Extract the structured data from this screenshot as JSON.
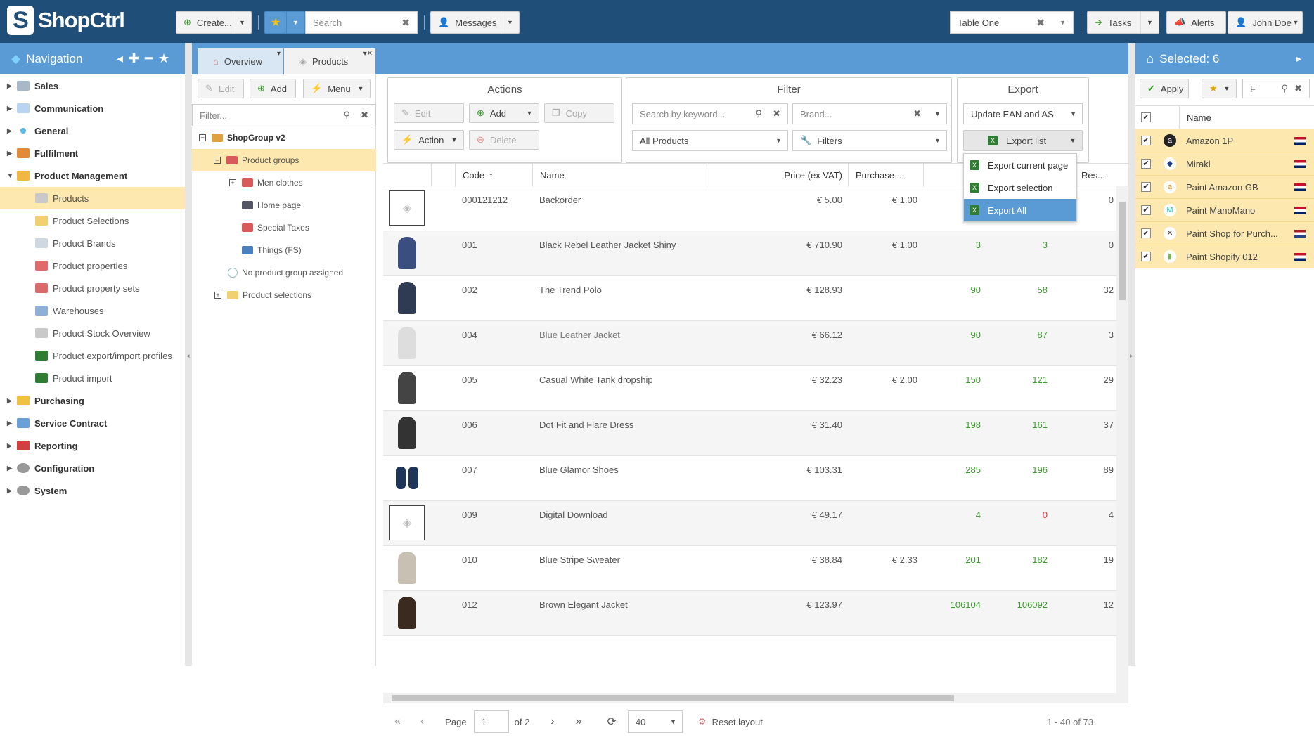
{
  "app": {
    "name": "ShopCtrl",
    "brand_color": "#1f4e79",
    "accent": "#5b9bd5",
    "selected_bg": "#fde9b0"
  },
  "topbar": {
    "create_label": "Create...",
    "search_placeholder": "Search",
    "messages_label": "Messages",
    "table_value": "Table One",
    "tasks_label": "Tasks",
    "alerts_label": "Alerts",
    "user_label": "John Doe"
  },
  "nav": {
    "title": "Navigation",
    "sections": [
      {
        "label": "Sales",
        "icon": "sales-icon"
      },
      {
        "label": "Communication",
        "icon": "chat-icon"
      },
      {
        "label": "General",
        "icon": "general-icon"
      },
      {
        "label": "Fulfilment",
        "icon": "box-icon"
      },
      {
        "label": "Product Management",
        "icon": "product-icon"
      }
    ],
    "product_items": [
      "Products",
      "Product Selections",
      "Product Brands",
      "Product properties",
      "Product property sets",
      "Warehouses",
      "Product Stock Overview",
      "Product export/import profiles",
      "Product import"
    ],
    "after_sections": [
      "Purchasing",
      "Service Contract",
      "Reporting",
      "Configuration",
      "System"
    ]
  },
  "tabs": {
    "overview": "Overview",
    "products": "Products"
  },
  "tree": {
    "edit": "Edit",
    "add": "Add",
    "menu": "Menu",
    "filter_placeholder": "Filter...",
    "root": "ShopGroup v2",
    "product_groups": "Product groups",
    "children": [
      "Men clothes",
      "Home page",
      "Special Taxes",
      "Things (FS)"
    ],
    "no_group": "No product group assigned",
    "selections": "Product selections"
  },
  "actions": {
    "title": "Actions",
    "edit": "Edit",
    "add": "Add",
    "copy": "Copy",
    "action": "Action",
    "delete": "Delete"
  },
  "filter": {
    "title": "Filter",
    "keyword_placeholder": "Search by keyword...",
    "brand_placeholder": "Brand...",
    "scope": "All Products",
    "filters": "Filters"
  },
  "export": {
    "title": "Export",
    "profile": "Update EAN and AS",
    "export_list": "Export list",
    "menu": [
      "Export current page",
      "Export selection",
      "Export All"
    ]
  },
  "grid": {
    "columns": [
      "Code",
      "Name",
      "Price (ex VAT)",
      "Purchase ...",
      "Res..."
    ],
    "rows": [
      {
        "code": "000121212",
        "name": "Backorder",
        "price": "€ 5.00",
        "purchase": "€ 1.00",
        "a": "",
        "b": "",
        "c": "0",
        "thumb": "placeholder"
      },
      {
        "code": "001",
        "name": "Black Rebel Leather Jacket Shiny",
        "price": "€ 710.90",
        "purchase": "€ 1.00",
        "a": "3",
        "b": "3",
        "c": "0",
        "thumb": "person"
      },
      {
        "code": "002",
        "name": "The Trend Polo",
        "price": "€ 128.93",
        "purchase": "",
        "a": "90",
        "b": "58",
        "c": "32",
        "thumb": "person"
      },
      {
        "code": "004",
        "name": "Blue Leather Jacket",
        "price": "€ 66.12",
        "purchase": "",
        "a": "90",
        "b": "87",
        "c": "3",
        "thumb": "person"
      },
      {
        "code": "005",
        "name": "Casual White Tank dropship",
        "price": "€ 32.23",
        "purchase": "€ 2.00",
        "a": "150",
        "b": "121",
        "c": "29",
        "thumb": "person"
      },
      {
        "code": "006",
        "name": "Dot Fit and Flare Dress",
        "price": "€ 31.40",
        "purchase": "",
        "a": "198",
        "b": "161",
        "c": "37",
        "thumb": "person"
      },
      {
        "code": "007",
        "name": "Blue Glamor Shoes",
        "price": "€ 103.31",
        "purchase": "",
        "a": "285",
        "b": "196",
        "c": "89",
        "thumb": "shoes"
      },
      {
        "code": "009",
        "name": "Digital Download",
        "price": "€ 49.17",
        "purchase": "",
        "a": "4",
        "b": "0",
        "c": "4",
        "thumb": "placeholder"
      },
      {
        "code": "010",
        "name": "Blue Stripe Sweater",
        "price": "€ 38.84",
        "purchase": "€ 2.33",
        "a": "201",
        "b": "182",
        "c": "19",
        "thumb": "person"
      },
      {
        "code": "012",
        "name": "Brown Elegant Jacket",
        "price": "€ 123.97",
        "purchase": "",
        "a": "106104",
        "b": "106092",
        "c": "12",
        "thumb": "person"
      }
    ]
  },
  "pager": {
    "page_label": "Page",
    "page": "1",
    "of": "of 2",
    "size": "40",
    "reset": "Reset layout",
    "range": "1 - 40 of 73"
  },
  "right": {
    "title": "Selected: 6",
    "apply": "Apply",
    "search_value": "F",
    "column": "Name",
    "channels": [
      "Amazon 1P",
      "Mirakl",
      "Paint Amazon GB",
      "Paint ManoMano",
      "Paint Shop for Purch...",
      "Paint Shopify 012"
    ]
  }
}
